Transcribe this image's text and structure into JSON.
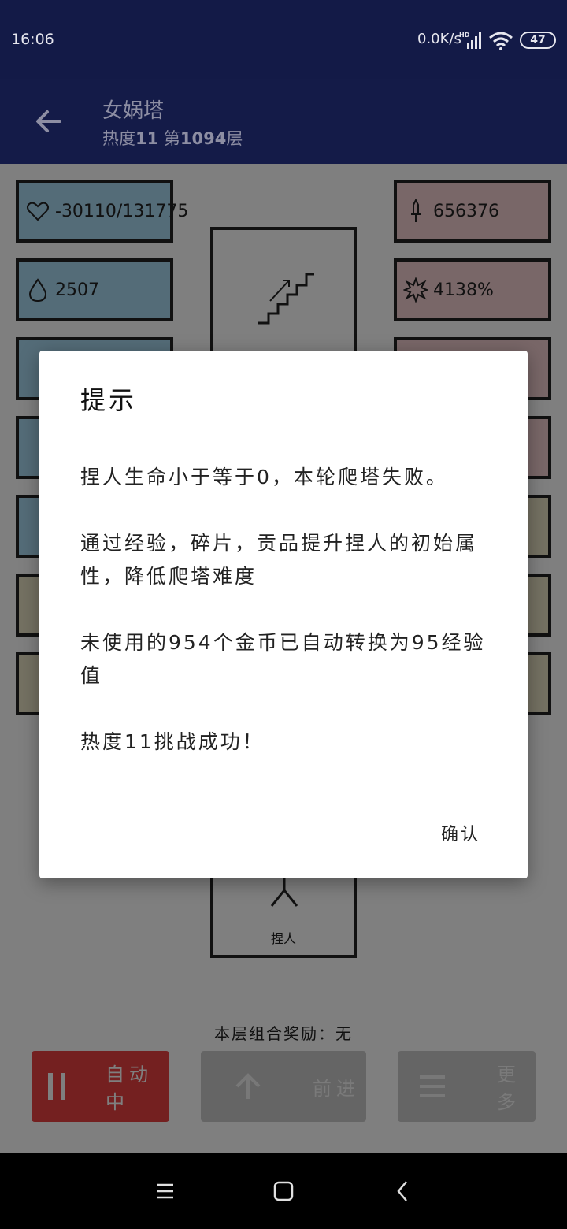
{
  "status_bar": {
    "time": "16:06",
    "net_speed": "0.0K/s",
    "network": "HD",
    "battery": "47"
  },
  "app_bar": {
    "title": "女娲塔",
    "heat_label": "热度",
    "heat_value": "11",
    "floor_prefix": "第",
    "floor_value": "1094",
    "floor_suffix": "层"
  },
  "stats_left": [
    {
      "icon": "heart-icon",
      "value": "-30110/131775",
      "color": "#a9d9f1"
    },
    {
      "icon": "water-drop-icon",
      "value": "2507",
      "color": "#a9d9f1"
    }
  ],
  "stats_right": [
    {
      "icon": "sword-icon",
      "value": "656376",
      "color": "#f3cfd0"
    },
    {
      "icon": "burst-icon",
      "value": "4138%",
      "color": "#f3cfd0"
    }
  ],
  "tower": {
    "character_name": "捏人"
  },
  "reward": {
    "text": "本层组合奖励：无"
  },
  "buttons": {
    "auto": "自动中",
    "forward": "前进",
    "more": "更多"
  },
  "dialog": {
    "title": "提示",
    "paragraphs": [
      "捏人生命小于等于0，本轮爬塔失败。",
      "通过经验，碎片，贡品提升捏人的初始属性，降低爬塔难度",
      "未使用的954个金币已自动转换为95经验值",
      "热度11挑战成功！"
    ],
    "confirm": "确认"
  }
}
